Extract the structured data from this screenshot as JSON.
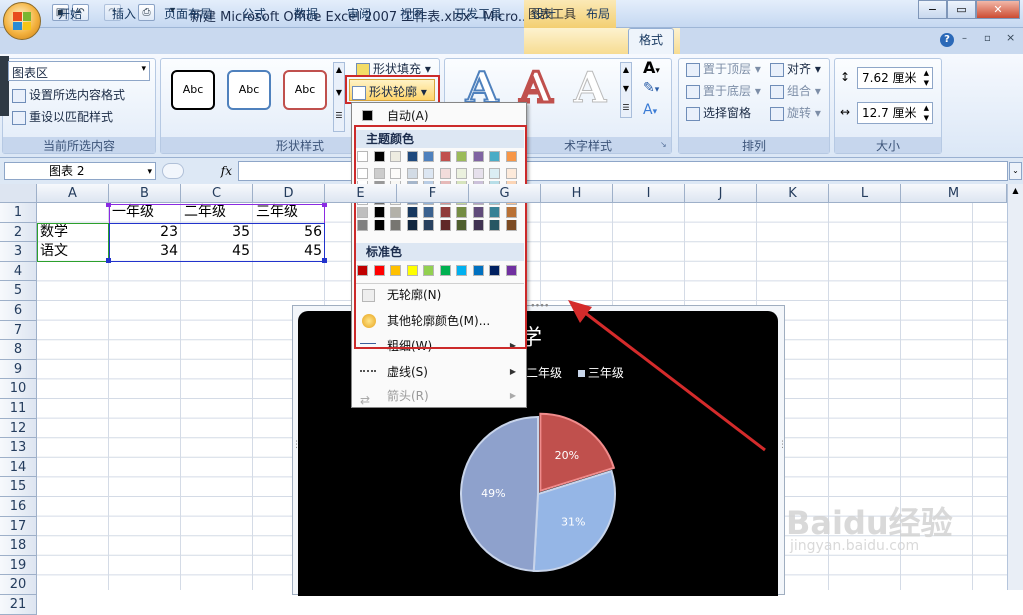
{
  "window": {
    "title": "新建 Microsoft Office Excel 2007 工作表.xlsx - Micro...",
    "context_tab": "图表工具"
  },
  "tabs": [
    "开始",
    "插入",
    "页面布局",
    "公式",
    "数据",
    "审阅",
    "视图",
    "开发工具",
    "设计",
    "布局",
    "格式"
  ],
  "active_tab": "格式",
  "ribbon": {
    "current_selection": {
      "dropdown_value": "图表区",
      "format_selection": "设置所选内容格式",
      "reset_style": "重设以匹配样式",
      "label": "当前所选内容"
    },
    "shape_styles": {
      "thumb_text": "Abc",
      "fill": "形状填充",
      "outline": "形状轮廓",
      "label": "形状样式"
    },
    "wordart": {
      "glyph": "A",
      "label": "艺术字样式",
      "visible_label": "术字样式"
    },
    "arrange": {
      "bring_front": "置于顶层",
      "send_back": "置于底层",
      "selection_pane": "选择窗格",
      "align": "对齐",
      "group": "组合",
      "rotate": "旋转",
      "label": "排列"
    },
    "size": {
      "height": "7.62 厘米",
      "width": "12.7 厘米",
      "label": "大小"
    }
  },
  "formula_bar": {
    "name_box": "图表 2",
    "fx": "fx",
    "value": ""
  },
  "columns": [
    "A",
    "B",
    "C",
    "D",
    "E",
    "F",
    "G",
    "H",
    "I",
    "J",
    "K",
    "L",
    "M"
  ],
  "rows": [
    "1",
    "2",
    "3",
    "4",
    "5",
    "6",
    "7",
    "8",
    "9",
    "10",
    "11",
    "12",
    "13",
    "14",
    "15",
    "16",
    "17",
    "18",
    "19",
    "20",
    "21"
  ],
  "sheet": {
    "r1": [
      "",
      "一年级",
      "二年级",
      "三年级"
    ],
    "r2": [
      "数学",
      "23",
      "35",
      "56"
    ],
    "r3": [
      "语文",
      "34",
      "45",
      "45"
    ]
  },
  "chart_data": {
    "type": "pie",
    "title": "数学",
    "visible_title": "数学",
    "categories": [
      "一年级",
      "二年级",
      "三年级"
    ],
    "legend_visible": [
      "二年级",
      "三年级"
    ],
    "values": [
      23,
      35,
      56
    ],
    "labels": [
      "20%",
      "31%",
      "49%"
    ],
    "colors": [
      "#c0504d",
      "#95b6e6",
      "#8ea1cc"
    ],
    "legend_placement": "top"
  },
  "menu": {
    "automatic": "自动(A)",
    "theme_colors_header": "主题颜色",
    "standard_colors_header": "标准色",
    "no_outline": "无轮廓(N)",
    "more_colors": "其他轮廓颜色(M)...",
    "weight": "粗细(W)",
    "dashes": "虚线(S)",
    "arrows": "箭头(R)",
    "theme_top": [
      "#ffffff",
      "#000000",
      "#eeece1",
      "#1f497d",
      "#4f81bd",
      "#c0504d",
      "#9bbb59",
      "#8064a2",
      "#4bacc6",
      "#f79646"
    ],
    "standard": [
      "#c00000",
      "#ff0000",
      "#ffc000",
      "#ffff00",
      "#92d050",
      "#00b050",
      "#00b0f0",
      "#0070c0",
      "#002060",
      "#7030a0"
    ]
  },
  "watermark": {
    "brand": "Baidu经验",
    "url": "jingyan.baidu.com"
  }
}
